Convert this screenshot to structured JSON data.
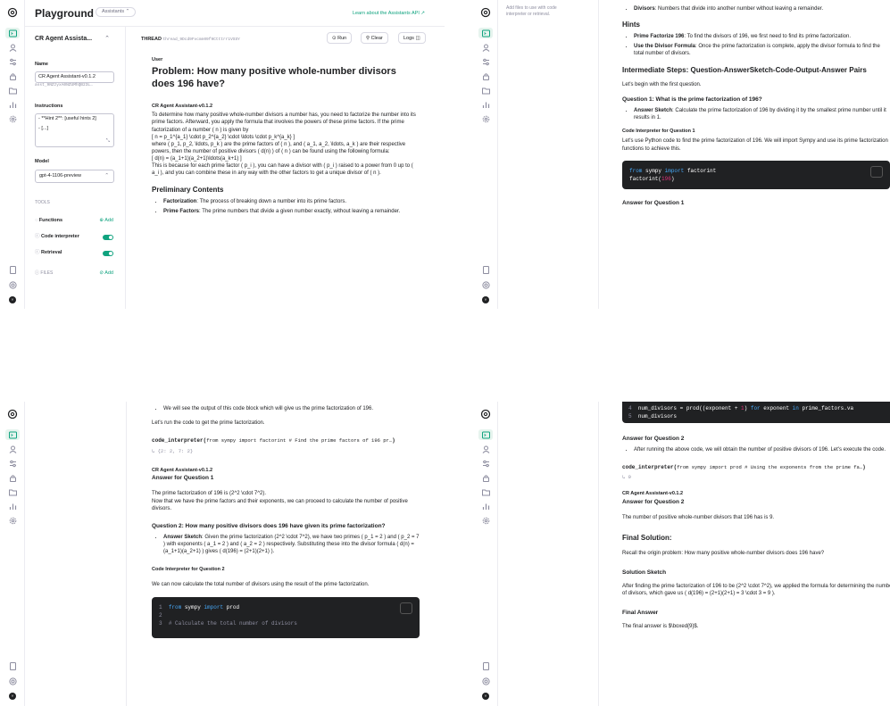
{
  "app": {
    "title": "Playground",
    "mode_badge": "Assistants",
    "top_link": "Learn about the Assistants API ↗",
    "user_initial": "Y"
  },
  "sidebar": {
    "assistant_name": "CR Agent Assista...",
    "name_label": "Name",
    "name_value": "CR Agent Assistant-v0.1.2",
    "assistant_id": "asst_9NZzyxA0NZUMhQB23L…",
    "instructions_label": "Instructions",
    "instructions_value_1": "- **Hint 2**: [useful hints 2]",
    "instructions_value_2": "- [...]",
    "model_label": "Model",
    "model_value": "gpt-4-1106-preview",
    "tools_label": "TOOLS",
    "functions_label": "Functions",
    "functions_add": "Add",
    "code_interpreter_label": "Code interpreter",
    "retrieval_label": "Retrieval",
    "files_label": "FILES",
    "files_add": "Add",
    "files_hint": "Add files to use with code interpreter or retrieval."
  },
  "thread": {
    "label": "THREAD",
    "id": "thread_9Dcd9Fvcmn09f9Ctttrr1VSSY",
    "run": "Run",
    "clear": "Clear",
    "logs": "Logs"
  },
  "q1": {
    "user_label": "User",
    "problem": "Problem: How many positive whole-number divisors does 196 have?",
    "assistant_label": "CR Agent Assistant-v0.1.2",
    "intro": "To determine how many positive whole-number divisors a number has, you need to factorize the number into its prime factors. Afterward, you apply the formula that involves the powers of these prime factors. If the prime factorization of a number ( n ) is given by",
    "formula1": "[ n = p_1^{a_1} \\cdot p_2^{a_2} \\cdot \\ldots \\cdot p_k^{a_k} ]",
    "where": "where ( p_1, p_2, \\ldots, p_k ) are the prime factors of ( n ), and ( a_1, a_2, \\ldots, a_k ) are their respective powers, then the number of positive divisors ( d(n) ) of ( n ) can be found using the following formula:",
    "formula2": "[ d(n) = (a_1+1)(a_2+1)\\ldots(a_k+1) ]",
    "because": "This is because for each prime factor ( p_i ), you can have a divisor with ( p_i ) raised to a power from 0 up to ( a_i ), and you can combine these in any way with the other factors to get a unique divisor of ( n ).",
    "prelim_title": "Preliminary Contents",
    "fact_term": "Factorization",
    "fact_def": ": The process of breaking down a number into its prime factors.",
    "prime_term": "Prime Factors",
    "prime_def": ": The prime numbers that divide a given number exactly, without leaving a remainder."
  },
  "q2": {
    "div_term": "Divisors",
    "div_def": ": Numbers that divide into another number without leaving a remainder.",
    "hints_title": "Hints",
    "hint1_term": "Prime Factorize 196",
    "hint1_def": ": To find the divisors of 196, we first need to find its prime factorization.",
    "hint2_term": "Use the Divisor Formula",
    "hint2_def": ": Once the prime factorization is complete, apply the divisor formula to find the total number of divisors.",
    "steps_title": "Intermediate Steps: Question-AnswerSketch-Code-Output-Answer Pairs",
    "lets_begin": "Let's begin with the first question.",
    "qa1_title": "Question 1: What is the prime factorization of 196?",
    "sketch_term": "Answer Sketch",
    "sketch1_def": ": Calculate the prime factorization of 196 by dividing it by the smallest prime number until it results in 1.",
    "ci1_title": "Code Interpreter for Question 1",
    "ci1_text": "Let's use Python code to find the prime factorization of 196. We will import Sympy and use its prime factorization functions to achieve this.",
    "code1_l1_kw1": "from",
    "code1_l1_mod": " sympy ",
    "code1_l1_kw2": "import",
    "code1_l1_rest": " factorint",
    "code1_l2_fn": "factorint(",
    "code1_l2_num": "196",
    "code1_l2_end": ")",
    "answer1_title": "Answer for Question 1"
  },
  "q3": {
    "bullet_top": "We will see the output of this code block which will give us the prime factorization of 196.",
    "lets_run": "Let's run the code to get the prime factorization.",
    "ci_call_fn": "code_interpreter(",
    "ci_call_arg": "from sympy import factorint # Find the prime factors of 196 pr…",
    "ci_call_end": ")",
    "ci_output": "↳ {2: 2, 7: 2}",
    "assistant_label": "CR Agent Assistant-v0.1.2",
    "answer1_title": "Answer for Question 1",
    "answer1_text": "The prime factorization of 196 is (2^2 \\cdot 7^2).",
    "answer1_text2": "Now that we have the prime factors and their exponents, we can proceed to calculate the number of positive divisors.",
    "qa2_title": "Question 2: How many positive divisors does 196 have given its prime factorization?",
    "sketch_term": "Answer Sketch",
    "sketch2_def": ": Given the prime factorization (2^2 \\cdot 7^2), we have two primes ( p_1 = 2 ) and ( p_2 = 7 ) with exponents ( a_1 = 2 ) and ( a_2 = 2 ) respectively. Substituting these into the divisor formula ( d(n) = (a_1+1)(a_2+1) ) gives ( d(196) = (2+1)(2+1) ).",
    "ci2_title": "Code Interpreter for Question 2",
    "ci2_text": "We can now calculate the total number of divisors using the result of the prime factorization.",
    "code2_l1_no": "1",
    "code2_l1_kw1": "from",
    "code2_l1_mod": " sympy ",
    "code2_l1_kw2": "import",
    "code2_l1_rest": " prod",
    "code2_l2_no": "2",
    "code2_l3_no": "3",
    "code2_l3_comment": "# Calculate the total number of divisors"
  },
  "q4": {
    "code_l4_no": "4",
    "code_l4_a": "num_divisors = prod((exponent + ",
    "code_l4_num": "1",
    "code_l4_b": ") ",
    "code_l4_kw1": "for",
    "code_l4_c": " exponent ",
    "code_l4_kw2": "in",
    "code_l4_d": " prime_factors.va",
    "code_l5_no": "5",
    "code_l5": "num_divisors",
    "answer2_title": "Answer for Question 2",
    "bullet_after": "After running the above code, we will obtain the number of positive divisors of 196. Let's execute the code.",
    "ci_call_fn": "code_interpreter(",
    "ci_call_arg": "from sympy import prod # Using the exponents from the prime fa…",
    "ci_call_end": ")",
    "ci_output": "↳ 9",
    "assistant_label": "CR Agent Assistant-v0.1.2",
    "answer2_title_b": "Answer for Question 2",
    "answer2_text": "The number of positive whole-number divisors that 196 has is 9.",
    "final_solution": "Final Solution:",
    "recall": "Recall the origin problem: How many positive whole-number divisors does 196 have?",
    "sketch_title": "Solution Sketch",
    "sketch_text": "After finding the prime factorization of 196 to be (2^2 \\cdot 7^2), we applied the formula for determining the number of divisors, which gave us ( d(196) = (2+1)(2+1) = 3 \\cdot 3 = 9 ).",
    "final_answer_title": "Final Answer",
    "final_answer_text": "The final answer is $\\boxed{9}$."
  }
}
